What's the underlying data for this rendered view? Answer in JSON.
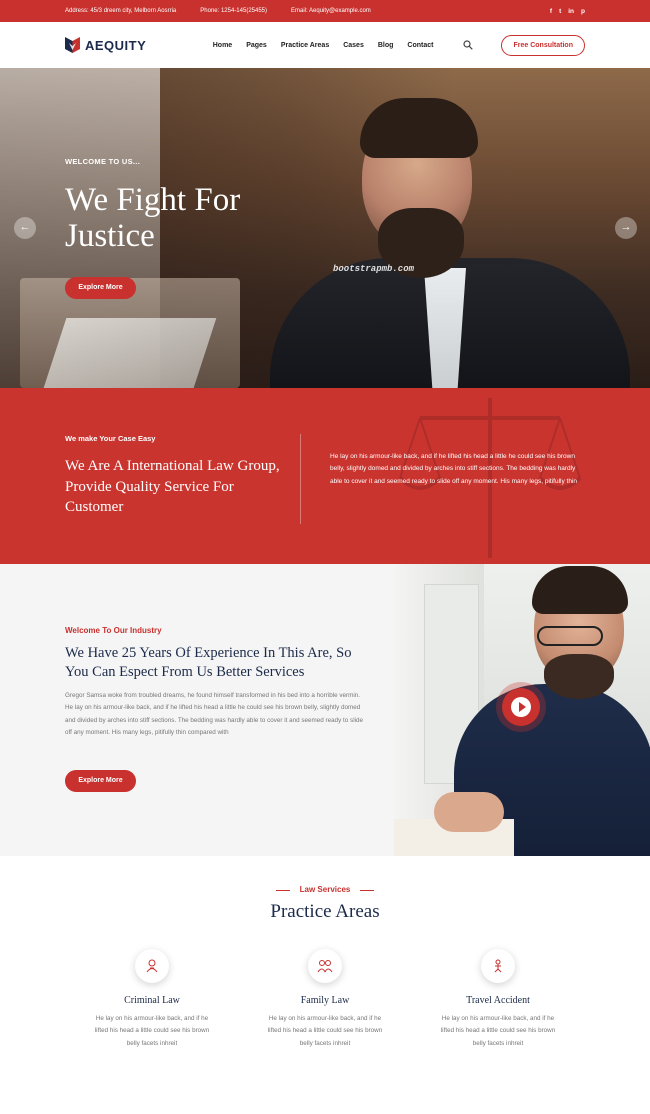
{
  "topbar": {
    "address": "Address: 45/3 dreem city, Melborn Aosrria",
    "phone": "Phone: 1254-145(25455)",
    "email": "Email: Aequity@example.com",
    "social": [
      "f",
      "t",
      "in",
      "p"
    ]
  },
  "nav": {
    "brand": "AEQUITY",
    "items": [
      "Home",
      "Pages",
      "Practice Areas",
      "Cases",
      "Blog",
      "Contact"
    ],
    "cta": "Free Consultation"
  },
  "hero": {
    "welcome": "WELCOME TO US...",
    "title": "We Fight For Justice",
    "button": "Explore More",
    "watermark": "bootstrapmb.com"
  },
  "band": {
    "small": "We make Your Case Easy",
    "headline": "We Are A International Law Group, Provide Quality Service For Customer",
    "paragraph": "He lay on his armour-like back, and if he lifted his head a little he could see his brown belly, slightly domed and divided by arches into stiff sections. The bedding was hardly able to cover it and seemed ready to slide off any moment. His many legs, pitifully thin"
  },
  "experience": {
    "small": "Welcome To Our Industry",
    "headline": "We Have 25 Years Of Experience In This Are, So You Can Espect From Us Better Services",
    "paragraph": "Gregor Samsa woke from troubled dreams, he found himself transformed in his bed into a horrible vermin. He lay on his armour-like back, and if he lifted his head a little he could see his brown belly, slightly domed and divided by arches into stiff sections. The bedding was hardly able to cover it and seemed ready to slide off any moment. His many legs, pitifully thin compared with",
    "button": "Explore More"
  },
  "practice": {
    "label": "Law Services",
    "title": "Practice Areas",
    "cards": [
      {
        "name": "Criminal Law",
        "desc": "He lay on his armour-like back, and if he lifted his head a little could see his brown belly facets inhreit",
        "icon": "criminal-icon"
      },
      {
        "name": "Family Law",
        "desc": "He lay on his armour-like back, and if he lifted his head a little could see his brown belly facets inhreit",
        "icon": "family-icon"
      },
      {
        "name": "Travel Accident",
        "desc": "He lay on his armour-like back, and if he lifted his head a little could see his brown belly facets inhreit",
        "icon": "travel-icon"
      }
    ]
  },
  "colors": {
    "accent": "#c8312e",
    "navy": "#1b2a4a"
  }
}
